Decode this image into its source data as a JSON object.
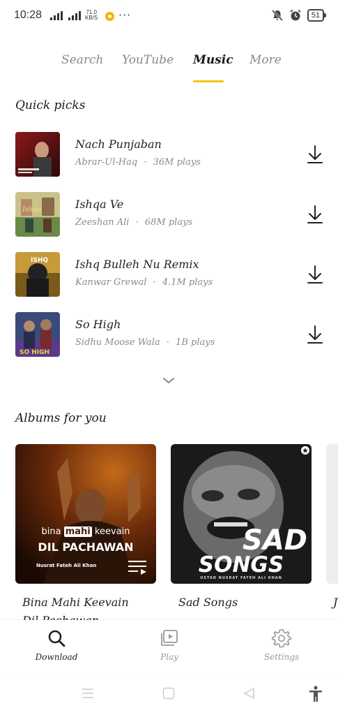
{
  "status_bar": {
    "time": "10:28",
    "net_speed_value": "71.0",
    "net_speed_unit": "KB/S",
    "battery": "51"
  },
  "tabs": [
    {
      "label": "Search",
      "active": false
    },
    {
      "label": "YouTube",
      "active": false
    },
    {
      "label": "Music",
      "active": true
    },
    {
      "label": "More",
      "active": false
    }
  ],
  "quick_picks": {
    "title": "Quick picks",
    "songs": [
      {
        "title": "Nach Punjaban",
        "artist": "Abrar-Ul-Haq",
        "plays": "36M plays"
      },
      {
        "title": "Ishqa Ve",
        "artist": "Zeeshan Ali",
        "plays": "68M plays"
      },
      {
        "title": "Ishq Bulleh Nu Remix",
        "artist": "Kanwar Grewal",
        "plays": "4.1M plays"
      },
      {
        "title": "So High",
        "artist": "Sidhu Moose Wala",
        "plays": "1B plays"
      }
    ],
    "meta_separator": "·"
  },
  "albums": {
    "title": "Albums for you",
    "items": [
      {
        "title": "Bina Mahi Keevain Dil Pachawan",
        "cover_line1_a": "bina",
        "cover_line1_b": "mahi",
        "cover_line1_c": "keevain",
        "cover_line2": "DIL PACHAWAN",
        "cover_artist": "Nusrat Fateh Ali Khan"
      },
      {
        "title": "Sad Songs",
        "cover_line1": "SAD",
        "cover_line2": "SONGS",
        "cover_artist": "USTAD NUSRAT FATEH ALI KHAN"
      }
    ],
    "partial_title": "J"
  },
  "bottom_nav": [
    {
      "label": "Download",
      "icon": "search-icon",
      "active": true
    },
    {
      "label": "Play",
      "icon": "video-library-icon",
      "active": false
    },
    {
      "label": "Settings",
      "icon": "gear-icon",
      "active": false
    }
  ]
}
